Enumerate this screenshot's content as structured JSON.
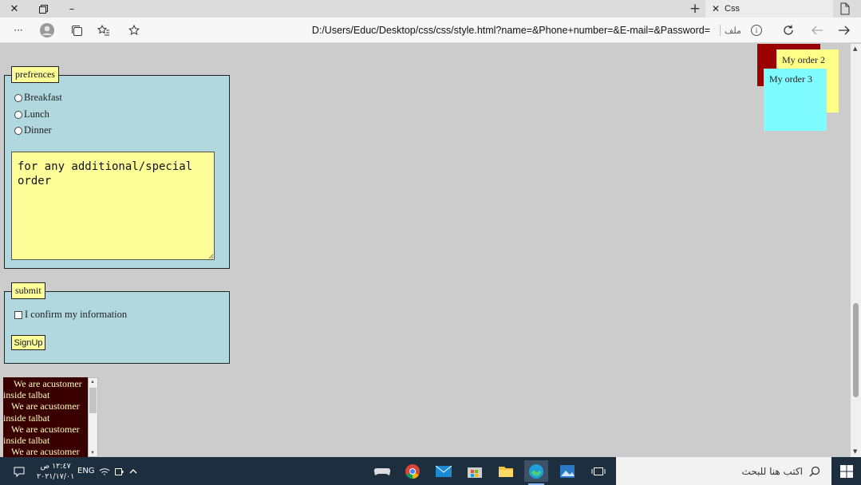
{
  "window": {
    "tab_title": "Css",
    "url": "D:/Users/Educ/Desktop/css/css/style.html?name=&Phone+number=&E-mail=&Password=",
    "file_label": "ملف"
  },
  "preferences": {
    "legend": "prefrences",
    "options": [
      "Breakfast",
      "Lunch",
      "Dinner"
    ],
    "textarea_value": "for any additional/special order"
  },
  "submit_section": {
    "legend": "submit",
    "confirm_label": "I confirm my information",
    "signup_label": "SignUp"
  },
  "marquee": {
    "lines": [
      "We are acustomer",
      "inside talbat",
      "We are acustomer",
      "inside talbat",
      "We are acustomer",
      "inside talbat",
      "We are acustomer"
    ]
  },
  "orders": {
    "order2": "My order 2",
    "order3": "My order 3"
  },
  "colors": {
    "fieldset_bg": "#b0d8de",
    "legend_bg": "#ffff99",
    "order1_bg": "#9b0000",
    "order2_bg": "#ffff88",
    "order3_bg": "#7ffcff",
    "marquee_bg": "#3a0000"
  },
  "taskbar": {
    "search_placeholder": "اكتب هنا للبحث",
    "language": "ENG",
    "time": "١٢:٤٧ ص",
    "date": "٢٠٢١/١٧/٠١"
  }
}
